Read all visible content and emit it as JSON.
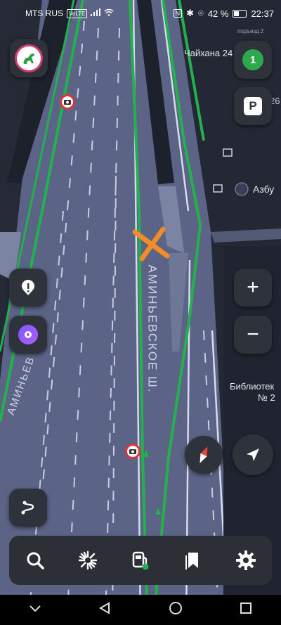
{
  "status_bar": {
    "carrier": "MTS RUS",
    "volte": "VoLTE",
    "battery": "42 %",
    "time": "22:37"
  },
  "map": {
    "street_name_main": "АМИНЬЕВСКОЕ Ш.",
    "street_name_left": "АМИНЬЕВ",
    "poi_chaikhana": "Чайхана 24",
    "poi_azbuka": "Азбу",
    "poi_library_line1": "Библиотек",
    "poi_library_line2": "№ 2",
    "entrance_label": "подъезд 2",
    "house_number": "26"
  },
  "controls": {
    "traffic_level": "1",
    "parking_label": "P",
    "zoom_in": "+",
    "zoom_out": "−"
  },
  "colors": {
    "route": "#22b14c",
    "road": "#5b6486",
    "marker": "#f28c28",
    "compass_red": "#e8453c"
  }
}
